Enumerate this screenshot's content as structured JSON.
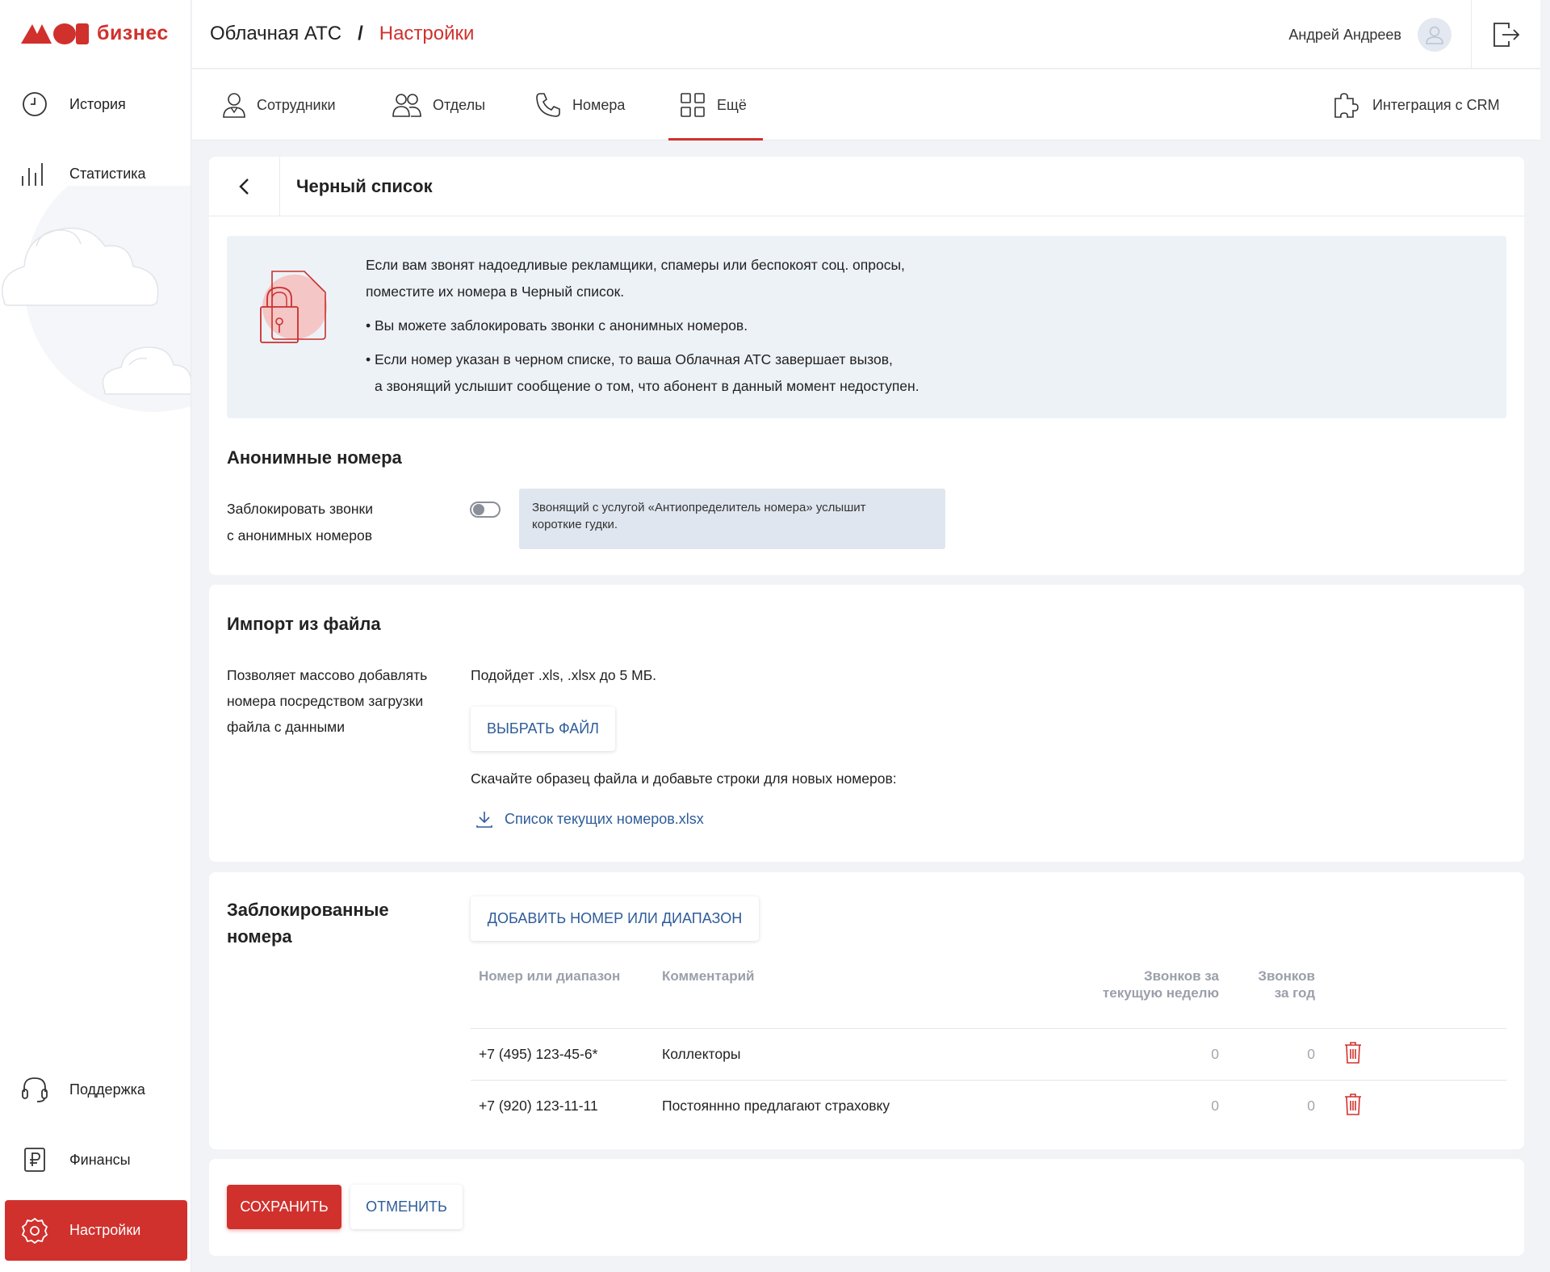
{
  "brand": {
    "logo_text": "бизнес",
    "accent": "#d0312d",
    "link_color": "#2e5c99"
  },
  "sidebar": {
    "top_items": [
      {
        "label": "История",
        "icon": "clock-icon"
      },
      {
        "label": "Статистика",
        "icon": "bar-chart-icon"
      }
    ],
    "bottom_items": [
      {
        "label": "Поддержка",
        "icon": "headset-icon"
      },
      {
        "label": "Финансы",
        "icon": "ruble-document-icon"
      },
      {
        "label": "Настройки",
        "icon": "gear-icon",
        "active": true
      }
    ]
  },
  "header": {
    "breadcrumb_root": "Облачная АТС",
    "breadcrumb_sep": "/",
    "breadcrumb_current": "Настройки",
    "user_name": "Андрей Андреев"
  },
  "tabs": [
    {
      "label": "Сотрудники",
      "icon": "user-icon"
    },
    {
      "label": "Отделы",
      "icon": "users-icon"
    },
    {
      "label": "Номера",
      "icon": "phone-icon"
    },
    {
      "label": "Ещё",
      "icon": "grid-icon",
      "active": true
    }
  ],
  "crm": {
    "label": "Интеграция с CRM",
    "icon": "puzzle-icon"
  },
  "blacklist": {
    "title": "Черный список",
    "info": {
      "line1": "Если вам звонят надоедливые рекламщики, спамеры или беспокоят соц. опросы,",
      "line2": "поместите их номера в Черный список.",
      "line3": "• Вы можете заблокировать звонки с анонимных номеров.",
      "line4": "• Если номер указан в черном списке, то ваша Облачная АТС завершает вызов,",
      "line5": "а звонящий услышит сообщение о том, что абонент в данный момент недоступен."
    },
    "anon": {
      "title": "Анонимные номера",
      "label_line1": "Заблокировать звонки",
      "label_line2": "с анонимных номеров",
      "toggle_on": false,
      "hint_line1": "Звонящий с услугой «Антиопределитель номера» услышит",
      "hint_line2": "короткие гудки."
    }
  },
  "import": {
    "title": "Импорт из файла",
    "desc_line1": "Позволяет массово добавлять",
    "desc_line2": "номера посредством загрузки",
    "desc_line3": "файла с данными",
    "formats": "Подойдет .xls, .xlsx до 5 МБ.",
    "choose_button": "Выбрать файл",
    "sample_text": "Скачайте образец файла и добавьте строки для новых номеров:",
    "download_link": "Список текущих номеров.xlsx"
  },
  "blocked": {
    "title_line1": "Заблокированные",
    "title_line2": "номера",
    "add_button": "Добавить номер или диапазон",
    "columns": {
      "number": "Номер или диапазон",
      "comment": "Комментарий",
      "week_line1": "Звонков за",
      "week_line2": "текущую неделю",
      "year_line1": "Звонков",
      "year_line2": "за год"
    },
    "rows": [
      {
        "number": "+7 (495) 123-45-6*",
        "comment": "Коллекторы",
        "week": "0",
        "year": "0"
      },
      {
        "number": "+7 (920) 123-11-11",
        "comment": "Постояннно предлагают страховку",
        "week": "0",
        "year": "0"
      }
    ]
  },
  "actions": {
    "save": "СОХРАНИТЬ",
    "cancel": "ОТМЕНИТЬ"
  }
}
